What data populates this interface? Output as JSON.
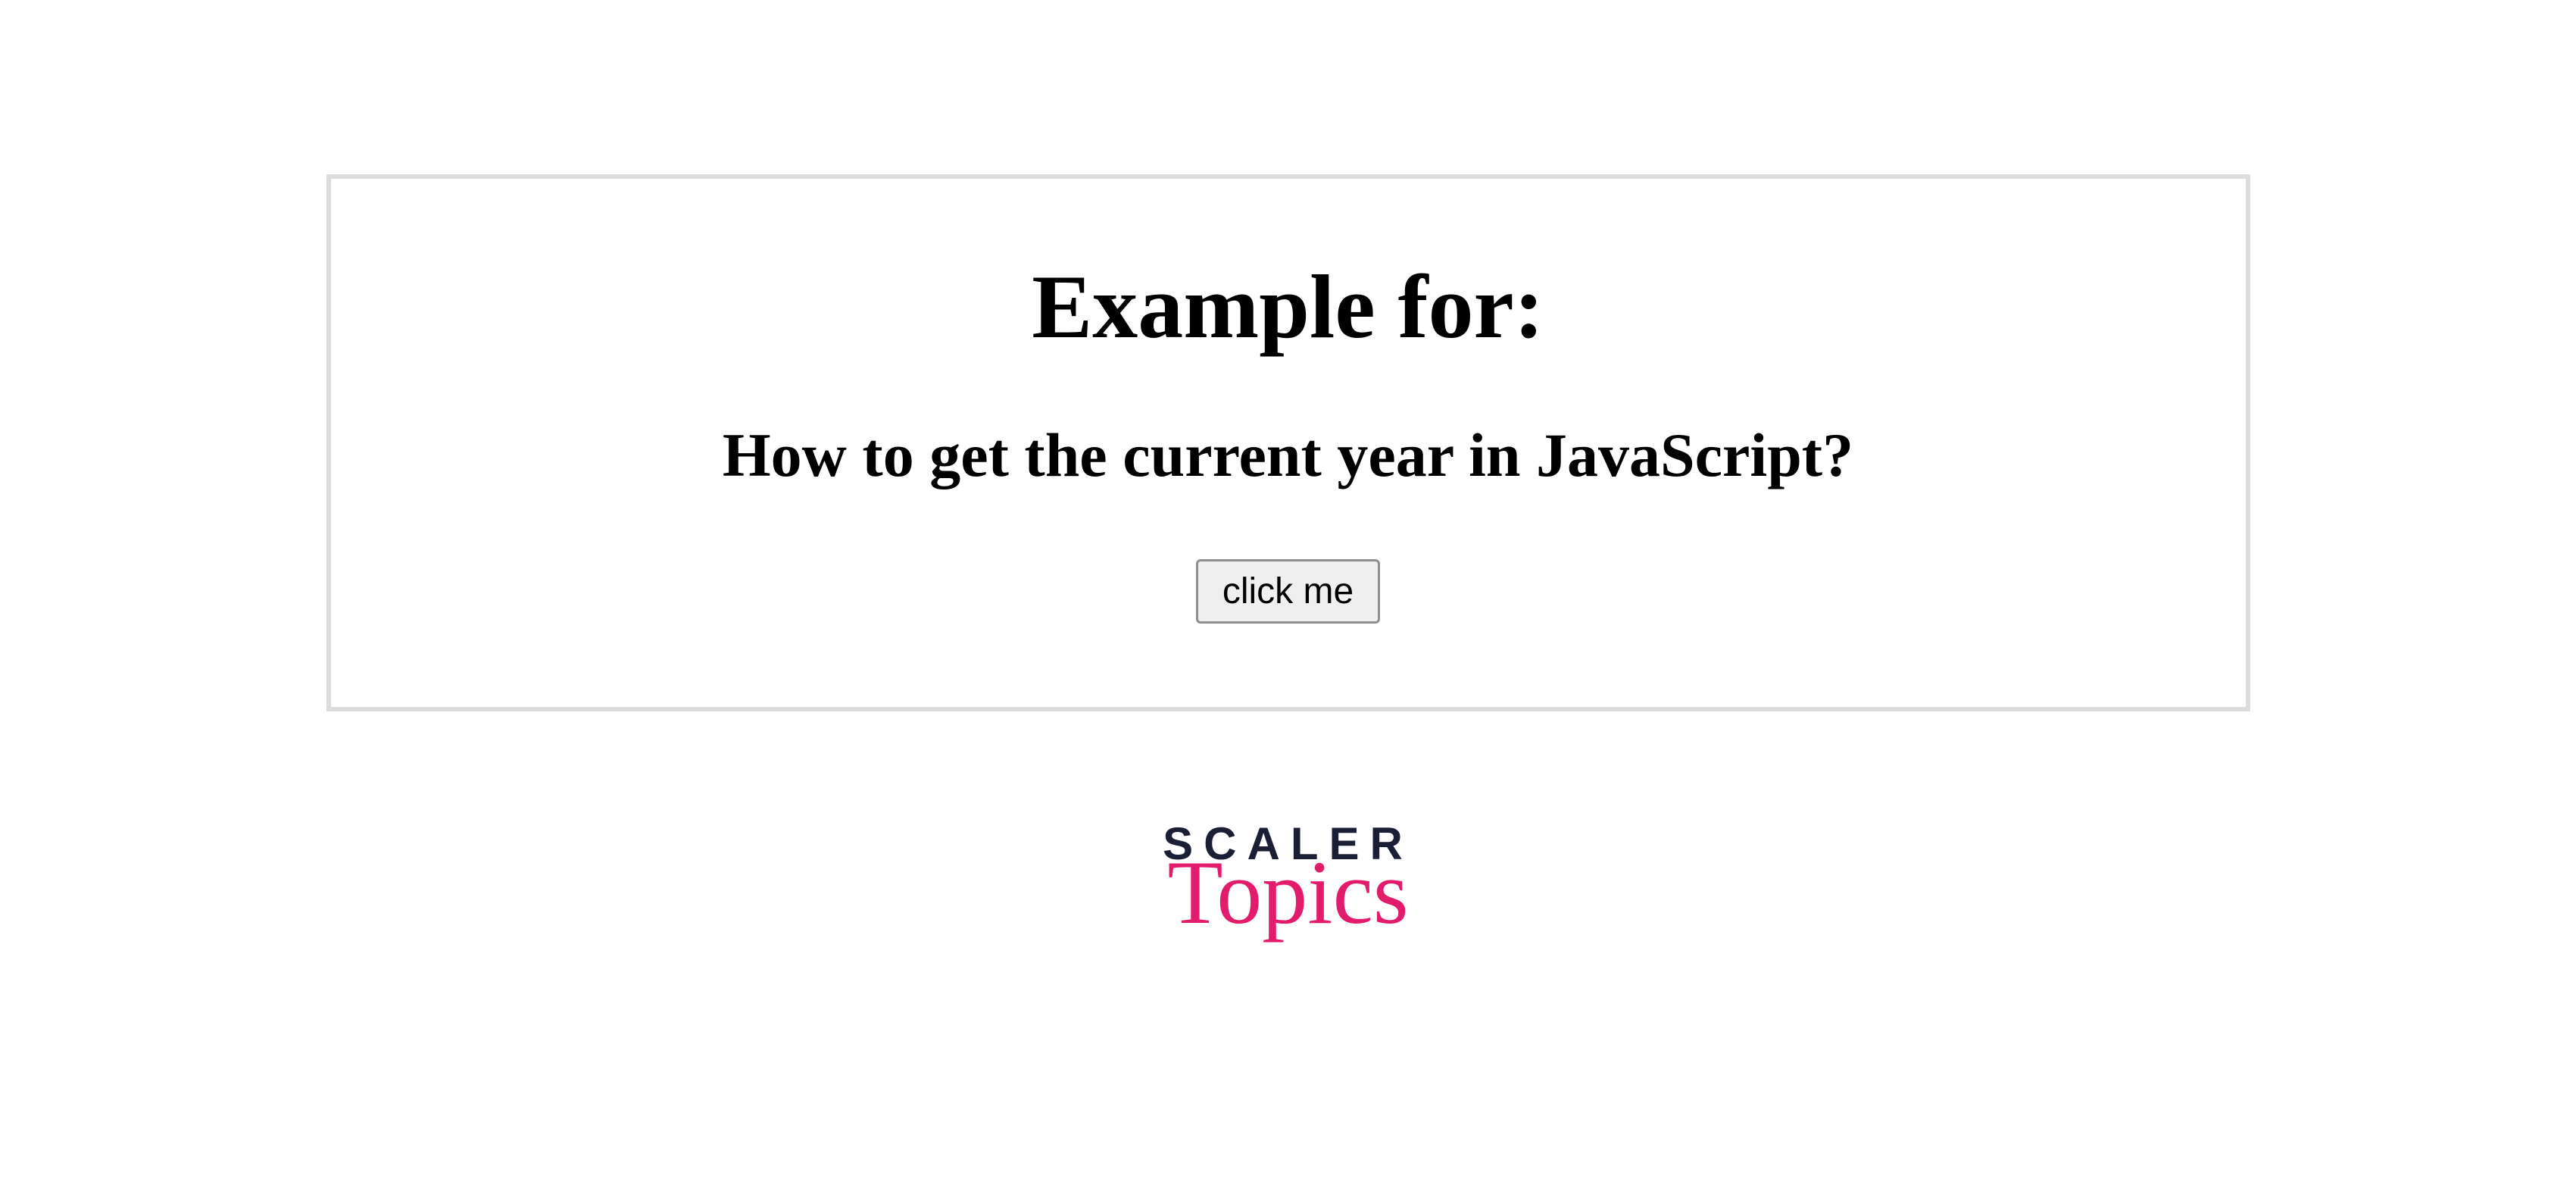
{
  "card": {
    "title": "Example for:",
    "subtitle": "How to get the current year in JavaScript?",
    "button_label": "click me"
  },
  "logo": {
    "line1": "SCALER",
    "line2": "Topics"
  }
}
